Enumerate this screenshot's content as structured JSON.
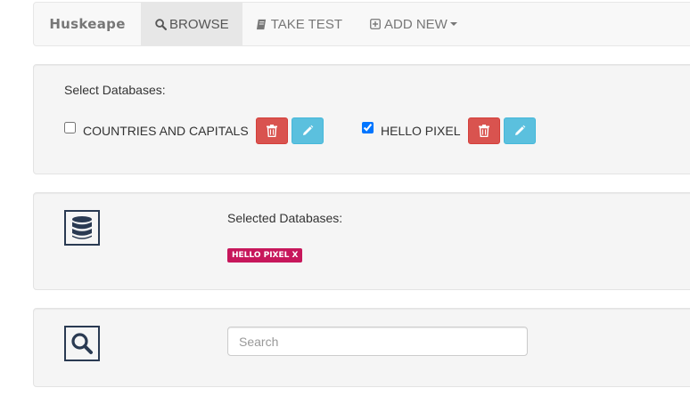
{
  "navbar": {
    "brand": "Huskeape",
    "items": [
      {
        "label": "BROWSE",
        "icon": "search-icon",
        "active": true
      },
      {
        "label": "TAKE TEST",
        "icon": "book-icon",
        "active": false
      },
      {
        "label": "ADD NEW",
        "icon": "plus-square-icon",
        "active": false,
        "dropdown": true
      }
    ]
  },
  "databases": {
    "heading": "Select Databases:",
    "entries": [
      {
        "name": "COUNTRIES AND CAPITALS",
        "checked": false
      },
      {
        "name": "HELLO PIXEL",
        "checked": true
      }
    ]
  },
  "selected": {
    "heading": "Selected Databases:",
    "badges": [
      "HELLO PIXEL X"
    ],
    "icon": "database-icon"
  },
  "search": {
    "placeholder": "Search",
    "value": "",
    "icon": "search-icon"
  },
  "colors": {
    "danger": "#d9534f",
    "info": "#5bc0de",
    "badge": "#c7175b",
    "icon_border": "#2a3a52"
  }
}
